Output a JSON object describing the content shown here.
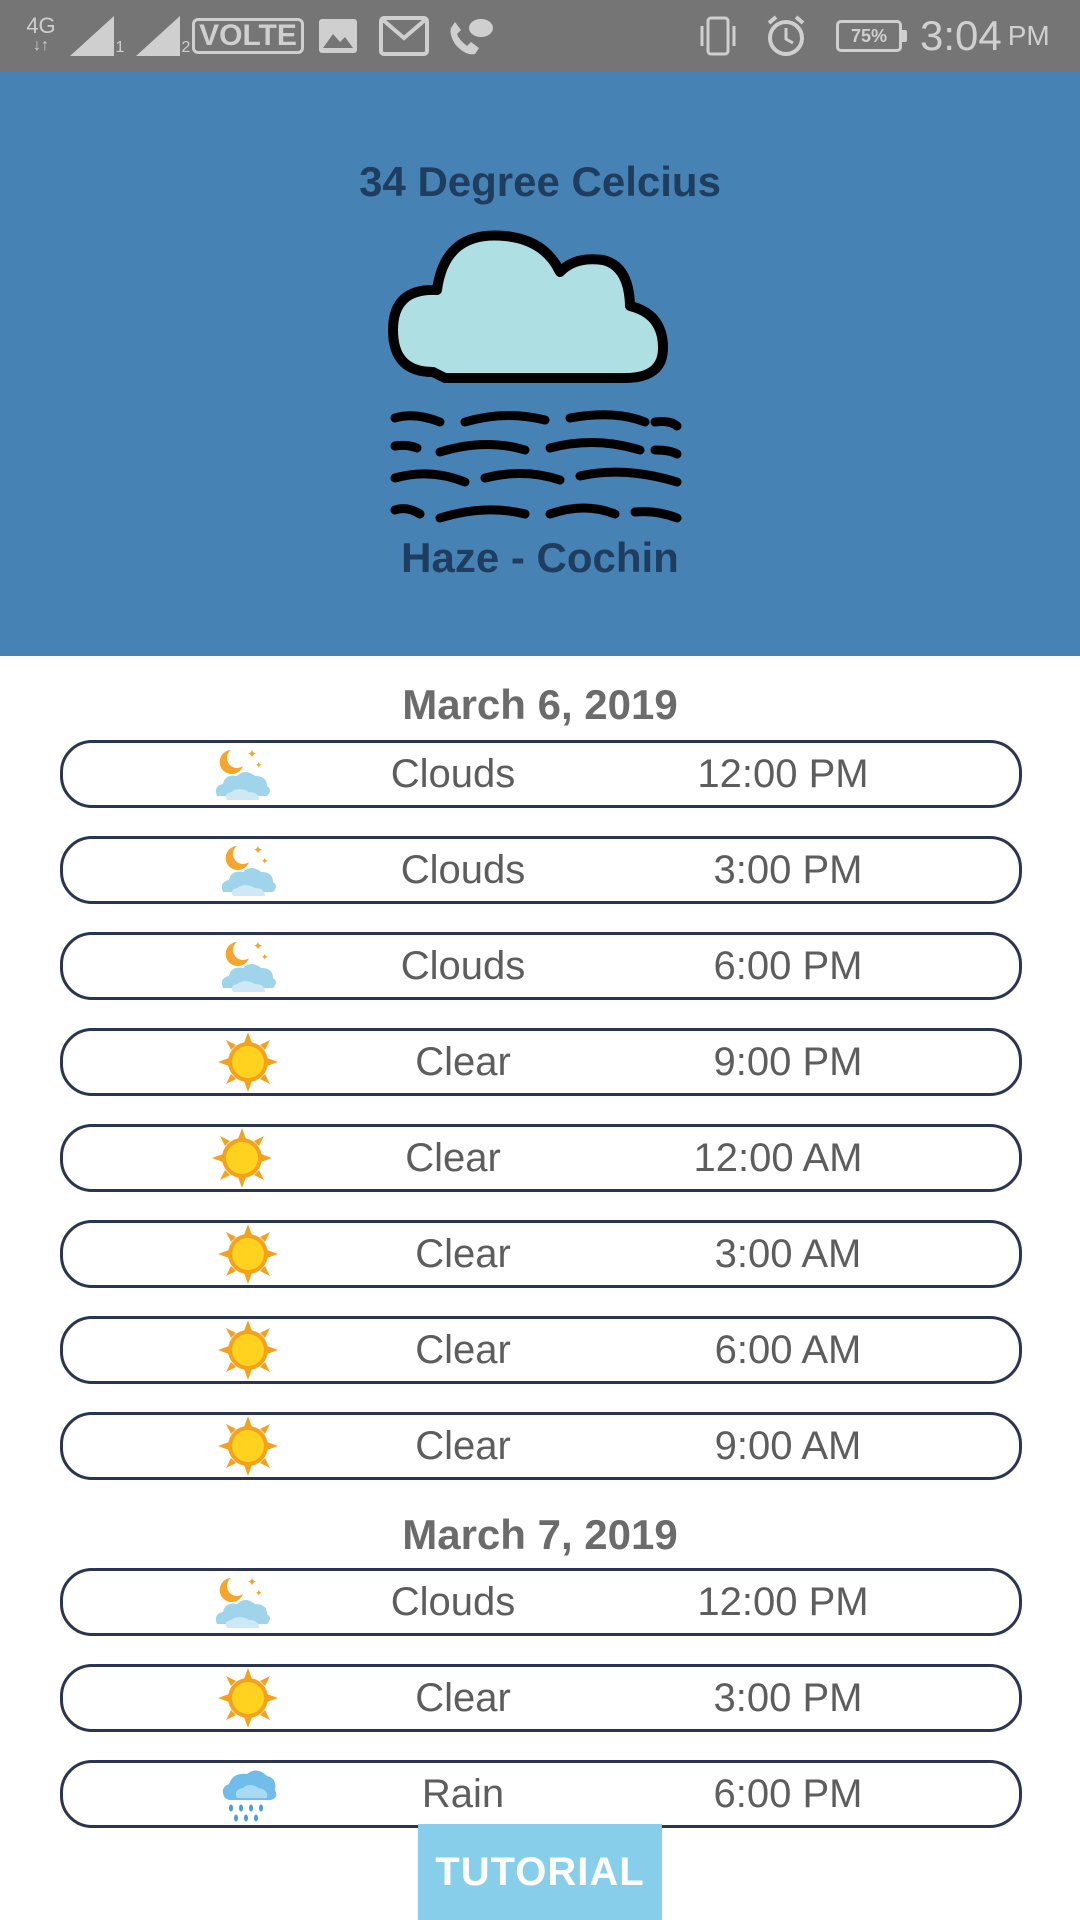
{
  "status_bar": {
    "network": "4G",
    "sim1": "1",
    "sim2": "2",
    "volte": "VOLTE",
    "battery": "75%",
    "time": "3:04",
    "ampm": "PM"
  },
  "header": {
    "temperature": "34 Degree Celcius",
    "condition_location": "Haze - Cochin",
    "background_color": "#4682b4",
    "icon": "haze-cloud-icon"
  },
  "days": [
    {
      "date": "March 6, 2019",
      "entries": [
        {
          "icon": "night-clouds-icon",
          "desc": "Clouds",
          "time": "12:00 PM"
        },
        {
          "icon": "night-clouds-icon",
          "desc": "Clouds",
          "time": "3:00 PM"
        },
        {
          "icon": "night-clouds-icon",
          "desc": "Clouds",
          "time": "6:00 PM"
        },
        {
          "icon": "sun-icon",
          "desc": "Clear",
          "time": "9:00 PM"
        },
        {
          "icon": "sun-icon",
          "desc": "Clear",
          "time": "12:00 AM"
        },
        {
          "icon": "sun-icon",
          "desc": "Clear",
          "time": "3:00 AM"
        },
        {
          "icon": "sun-icon",
          "desc": "Clear",
          "time": "6:00 AM"
        },
        {
          "icon": "sun-icon",
          "desc": "Clear",
          "time": "9:00 AM"
        }
      ]
    },
    {
      "date": "March 7, 2019",
      "entries": [
        {
          "icon": "night-clouds-icon",
          "desc": "Clouds",
          "time": "12:00 PM"
        },
        {
          "icon": "sun-icon",
          "desc": "Clear",
          "time": "3:00 PM"
        },
        {
          "icon": "rain-cloud-icon",
          "desc": "Rain",
          "time": "6:00 PM"
        }
      ]
    }
  ],
  "tutorial_button": "TUTORIAL",
  "colors": {
    "tutorial": "#87ceeb",
    "row_border": "#2b3450",
    "text": "#5d5d5d"
  }
}
